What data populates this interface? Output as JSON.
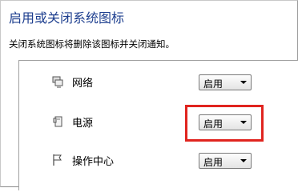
{
  "window": {
    "title": "启用或关闭系统图标",
    "description": "关闭系统图标将删除该图标并关闭通知。"
  },
  "icons": [
    {
      "name": "network-icon",
      "label": "网络",
      "value": "启用"
    },
    {
      "name": "power-icon",
      "label": "电源",
      "value": "启用"
    },
    {
      "name": "action-center-flag-icon",
      "label": "操作中心",
      "value": "启用"
    }
  ],
  "colors": {
    "title": "#1e3f8f",
    "highlight": "#e0241f"
  }
}
